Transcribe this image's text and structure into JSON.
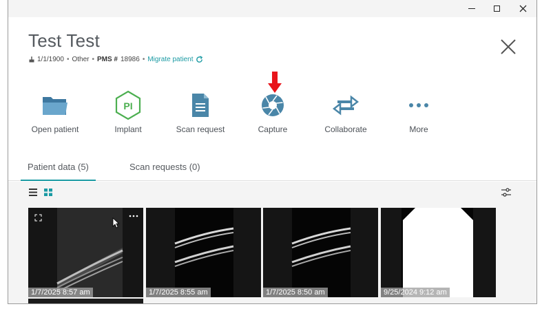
{
  "window": {
    "controls": {
      "minimize": "minimize",
      "maximize": "maximize",
      "close": "close"
    }
  },
  "patient": {
    "name": "Test Test",
    "birthdate": "1/1/1900",
    "gender": "Other",
    "pms_label": "PMS #",
    "pms_number": "18986",
    "migrate_label": "Migrate patient"
  },
  "actions": [
    {
      "label": "Open patient",
      "icon": "folder-icon"
    },
    {
      "label": "Implant",
      "icon": "implant-hexagon-icon"
    },
    {
      "label": "Scan request",
      "icon": "document-icon"
    },
    {
      "label": "Capture",
      "icon": "aperture-icon"
    },
    {
      "label": "Collaborate",
      "icon": "swap-arrows-icon"
    },
    {
      "label": "More",
      "icon": "more-dots-icon"
    }
  ],
  "tabs": [
    {
      "label": "Patient data (5)",
      "active": true
    },
    {
      "label": "Scan requests (0)",
      "active": false
    }
  ],
  "thumbnails": [
    {
      "date": "1/7/2025 8:57 am"
    },
    {
      "date": "1/7/2025 8:55 am"
    },
    {
      "date": "1/7/2025 8:50 am"
    },
    {
      "date": "9/25/2024 9:12 am"
    }
  ],
  "colors": {
    "accent": "#1a9aa3",
    "icon_blue": "#4a86a8",
    "implant_green": "#4caf50",
    "arrow_red": "#e8151b"
  }
}
